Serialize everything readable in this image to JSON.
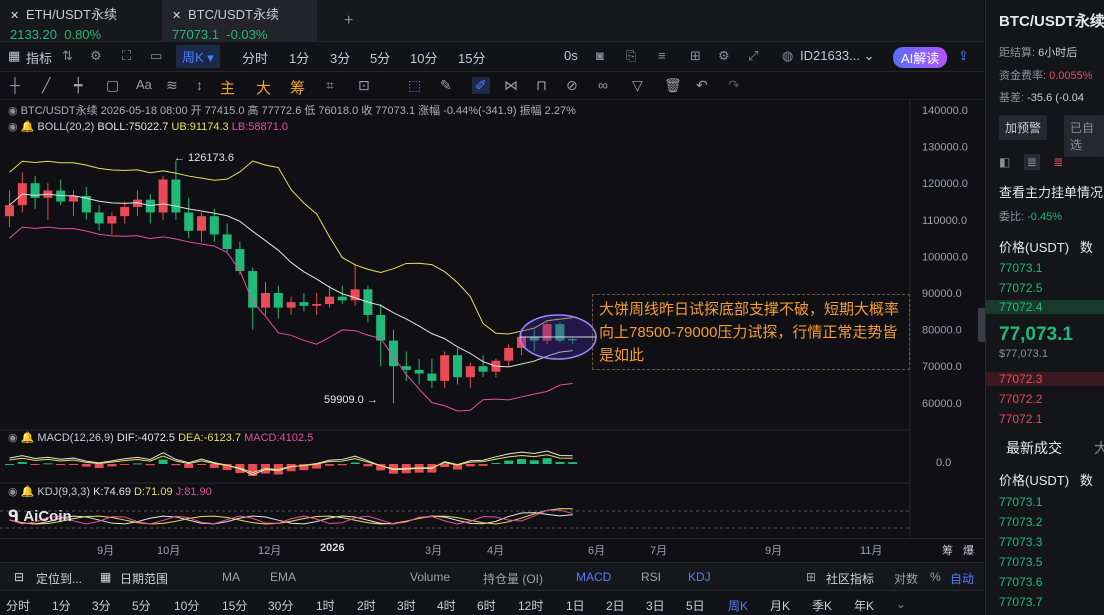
{
  "tabs": [
    {
      "name": "ETH/USDT永续",
      "price": "2133.20",
      "change": "0.80%"
    },
    {
      "name": "BTC/USDT永续",
      "price": "77073.1",
      "change": "-0.03%"
    }
  ],
  "tab_add": "+",
  "toolbar": {
    "indicator": "指标",
    "interval_selected": "周K",
    "intervals": [
      "分时",
      "1分",
      "3分",
      "5分",
      "10分",
      "15分"
    ],
    "zero_s": "0s",
    "account": "ID21633...",
    "ai": "AI解读"
  },
  "drawbar": {
    "main": "主",
    "big": "大",
    "chips": "筹",
    "font": "Aa"
  },
  "chart_info": {
    "line1": "BTC/USDT永续  2026-05-18 08:00  开 77415.0  高 77772.6  低 76018.0  收 77073.1  涨幅 -0.44%(-341.9)  振幅 2.27%",
    "boll_label": "BOLL(20,2)",
    "boll_mid": "BOLL:75022.7",
    "boll_ub": "UB:91174.3",
    "boll_lb": "LB:58871.0",
    "macd_label": "MACD(12,26,9)",
    "dif": "DIF:-4072.5",
    "dea": "DEA:-6123.7",
    "macd": "MACD:4102.5",
    "kdj_label": "KDJ(9,3,3)",
    "k": "K:74.69",
    "d": "D:71.09",
    "j": "J:81.90",
    "high_mark": "← 126173.6",
    "low_mark": "59909.0 →",
    "watermark": "AiCoin"
  },
  "annotation": "大饼周线昨日试探底部支撑不破，短期大概率向上78500-79000压力试探，行情正常走势皆是如此",
  "price_axis": [
    "140000.0",
    "130000.0",
    "120000.0",
    "110000.0",
    "100000.0",
    "90000.0",
    "80000.0",
    "70000.0",
    "60000.0"
  ],
  "macd_axis": "0.0",
  "x_axis": [
    "9月",
    "10月",
    "12月",
    "2026",
    "3月",
    "4月",
    "6月",
    "7月",
    "9月",
    "11月",
    "筹",
    "爆"
  ],
  "indicators_bar": {
    "locate": "定位到...",
    "range": "日期范围",
    "items": [
      "MA",
      "EMA",
      "Volume",
      "持仓量 (OI)",
      "MACD",
      "RSI",
      "KDJ"
    ],
    "community": "社区指标",
    "log": "对数",
    "pct": "%",
    "auto": "自动"
  },
  "timeframes": [
    "分时",
    "1分",
    "3分",
    "5分",
    "10分",
    "15分",
    "30分",
    "1时",
    "2时",
    "3时",
    "4时",
    "6时",
    "12时",
    "1日",
    "2日",
    "3日",
    "5日",
    "周K",
    "月K",
    "季K",
    "年K"
  ],
  "timeframe_selected": "周K",
  "right": {
    "title": "BTC/USDT永续",
    "settle_label": "距结算:",
    "settle_val": "6小时后",
    "fund_label": "资金费率:",
    "fund_val": "0.0055%",
    "basis_label": "基差:",
    "basis_val": "-35.6 (-0.04",
    "alert": "加预警",
    "added": "已自选",
    "depth": "查看主力挂单情况",
    "ratio_label": "委比:",
    "ratio_val": "-0.45%",
    "price_hdr": "价格(USDT)",
    "qty_hdr": "数",
    "asks": [
      "77073.1",
      "77072.5",
      "77072.4"
    ],
    "last": "77,073.1",
    "last_sub": "$77,073.1",
    "bids": [
      "77072.3",
      "77072.2",
      "77072.1"
    ],
    "trades_tab": "最新成交",
    "trades_tab2": "大",
    "trades_hdr": "价格(USDT)",
    "trades_qty": "数",
    "trades": [
      "77073.1",
      "77073.2",
      "77073.3",
      "77073.5",
      "77073.6",
      "77073.7"
    ]
  },
  "colors": {
    "up": "#1fb979",
    "down": "#e94a56",
    "accent": "#4f7cff",
    "annotation": "#f39c34"
  },
  "chart_data": {
    "type": "candlestick",
    "interval": "weekly",
    "ylim": [
      55000,
      142000
    ],
    "candles": [
      [
        111000,
        118000,
        108000,
        114000
      ],
      [
        114000,
        123000,
        112000,
        120000
      ],
      [
        120000,
        122000,
        113000,
        116000
      ],
      [
        116000,
        120000,
        110000,
        118000
      ],
      [
        118000,
        121000,
        114000,
        115000
      ],
      [
        115000,
        118000,
        111000,
        116500
      ],
      [
        116500,
        119000,
        110000,
        112000
      ],
      [
        112000,
        114000,
        107000,
        109000
      ],
      [
        109000,
        112000,
        106000,
        111000
      ],
      [
        111000,
        115000,
        109000,
        113500
      ],
      [
        113500,
        118000,
        111000,
        115500
      ],
      [
        115500,
        117000,
        109000,
        112000
      ],
      [
        112000,
        122000,
        110000,
        121000
      ],
      [
        121000,
        126173.6,
        110000,
        112000
      ],
      [
        112000,
        116000,
        105000,
        107000
      ],
      [
        107000,
        112000,
        104000,
        111000
      ],
      [
        111000,
        113000,
        104000,
        106000
      ],
      [
        106000,
        109000,
        101000,
        102000
      ],
      [
        102000,
        104000,
        95000,
        96000
      ],
      [
        96000,
        97000,
        80000,
        86000
      ],
      [
        86000,
        93000,
        84000,
        90000
      ],
      [
        90000,
        92000,
        83000,
        86000
      ],
      [
        86000,
        89000,
        84000,
        87500
      ],
      [
        87500,
        90000,
        85000,
        86500
      ],
      [
        86500,
        90000,
        84000,
        87000
      ],
      [
        87000,
        92000,
        86000,
        89000
      ],
      [
        89000,
        92000,
        87000,
        88000
      ],
      [
        88000,
        98000,
        86500,
        91000
      ],
      [
        91000,
        92000,
        82000,
        84000
      ],
      [
        84000,
        87000,
        70000,
        77000
      ],
      [
        77000,
        80000,
        59909,
        70000
      ],
      [
        70000,
        74000,
        66000,
        69000
      ],
      [
        69000,
        72000,
        65000,
        68000
      ],
      [
        68000,
        72000,
        64000,
        66000
      ],
      [
        66000,
        74000,
        64000,
        73000
      ],
      [
        73000,
        75000,
        65000,
        67000
      ],
      [
        67000,
        71000,
        64000,
        70000
      ],
      [
        70000,
        73000,
        67000,
        68500
      ],
      [
        68500,
        72000,
        67000,
        71500
      ],
      [
        71500,
        76000,
        70000,
        75000
      ],
      [
        75000,
        79000,
        73000,
        78000
      ],
      [
        78000,
        80000,
        74000,
        77000
      ],
      [
        77000,
        82000,
        76000,
        81500
      ],
      [
        81500,
        82000,
        76500,
        77000
      ],
      [
        77415,
        77772.6,
        76018,
        77073.1
      ]
    ]
  }
}
